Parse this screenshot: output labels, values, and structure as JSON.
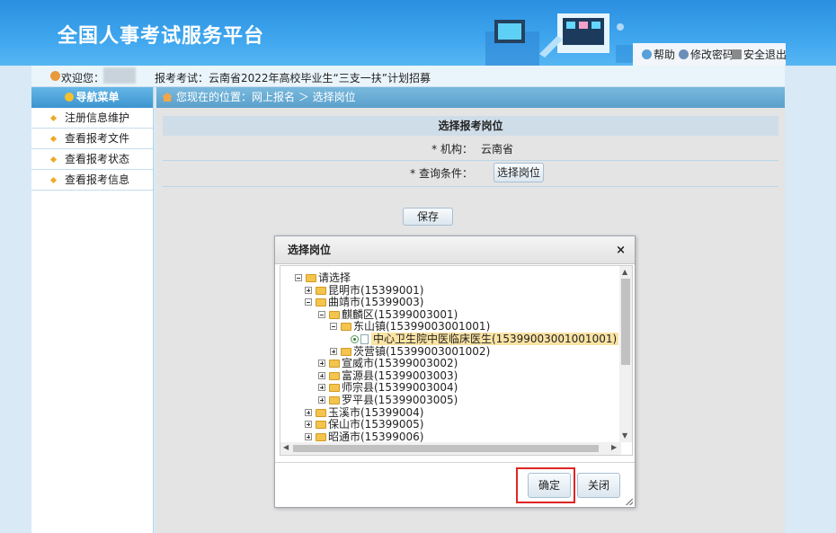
{
  "header": {
    "site_title": "全国人事考试服务平台",
    "links": {
      "help": "帮助",
      "change_password": "修改密码",
      "logout": "安全退出"
    }
  },
  "welcome": {
    "label": "欢迎您：",
    "exam_label": "报考考试：云南省2022年高校毕业生“三支一扶”计划招募"
  },
  "sidebar": {
    "header": "导航菜单",
    "items": [
      {
        "label": "注册信息维护"
      },
      {
        "label": "查看报考文件"
      },
      {
        "label": "查看报考状态"
      },
      {
        "label": "查看报考信息"
      }
    ]
  },
  "breadcrumb": "您现在的位置：网上报名 ＞ 选择岗位",
  "form": {
    "title": "选择报考岗位",
    "org_label": "* 机构：",
    "org_value": "云南省",
    "query_label": "* 查询条件：",
    "select_position_button": "选择岗位",
    "save_button": "保存"
  },
  "dialog": {
    "title": "选择岗位",
    "close_symbol": "×",
    "tree": [
      {
        "text": "请选择",
        "toggle": "minus",
        "icon": "folder"
      },
      {
        "text": "昆明市(15399001)",
        "toggle": "plus",
        "icon": "folder"
      },
      {
        "text": "曲靖市(15399003)",
        "toggle": "minus",
        "icon": "folder"
      },
      {
        "text": "麒麟区(15399003001)",
        "toggle": "minus",
        "icon": "folder"
      },
      {
        "text": "东山镇(15399003001001)",
        "toggle": "minus",
        "icon": "folder"
      },
      {
        "text": "中心卫生院中医临床医生(15399003001001001)",
        "toggle": "radio",
        "icon": "file",
        "selected": true
      },
      {
        "text": "茨营镇(15399003001002)",
        "toggle": "plus",
        "icon": "folder"
      },
      {
        "text": "宣威市(15399003002)",
        "toggle": "plus",
        "icon": "folder"
      },
      {
        "text": "富源县(15399003003)",
        "toggle": "plus",
        "icon": "folder"
      },
      {
        "text": "师宗县(15399003004)",
        "toggle": "plus",
        "icon": "folder"
      },
      {
        "text": "罗平县(15399003005)",
        "toggle": "plus",
        "icon": "folder"
      },
      {
        "text": "玉溪市(15399004)",
        "toggle": "plus",
        "icon": "folder"
      },
      {
        "text": "保山市(15399005)",
        "toggle": "plus",
        "icon": "folder"
      },
      {
        "text": "昭通市(15399006)",
        "toggle": "plus",
        "icon": "folder"
      }
    ],
    "confirm_button": "确定",
    "close_button": "关闭"
  },
  "colors": {
    "header_blue": "#3fa6ee",
    "selection": "#fbe3a4",
    "highlight_red": "#e02424"
  }
}
